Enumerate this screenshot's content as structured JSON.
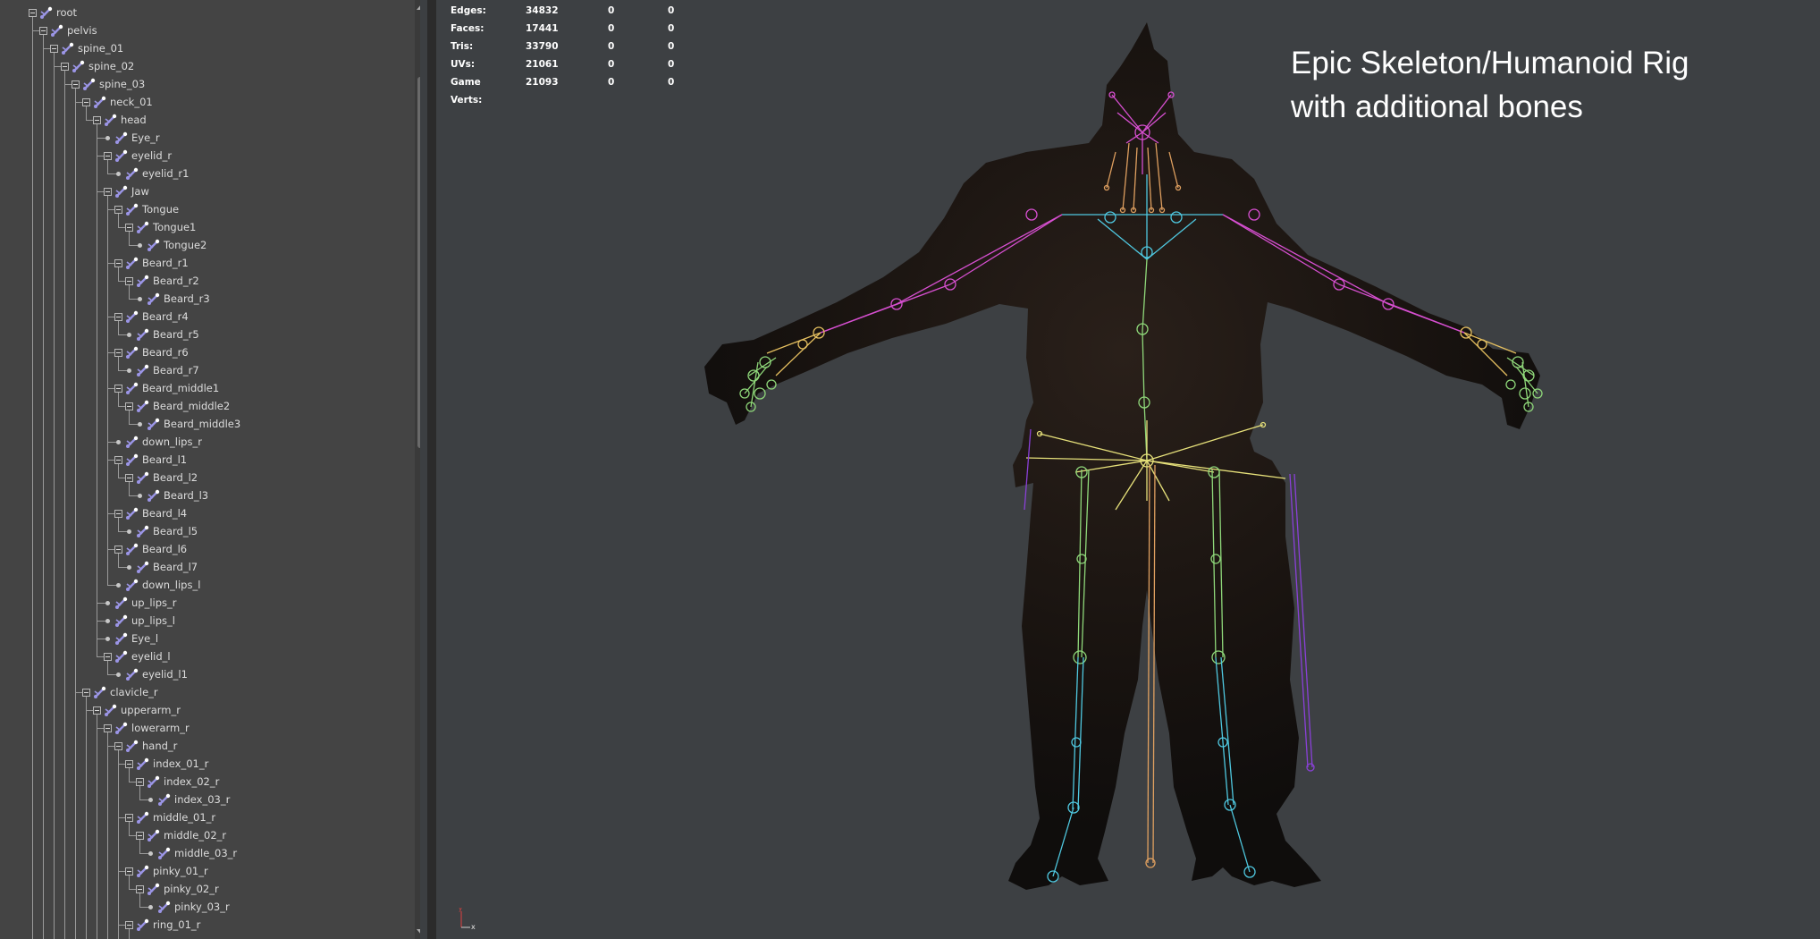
{
  "outliner": {
    "nodes": [
      {
        "label": "root",
        "depth": 0,
        "exp": true
      },
      {
        "label": "pelvis",
        "depth": 1,
        "exp": true
      },
      {
        "label": "spine_01",
        "depth": 2,
        "exp": true
      },
      {
        "label": "spine_02",
        "depth": 3,
        "exp": true
      },
      {
        "label": "spine_03",
        "depth": 4,
        "exp": true
      },
      {
        "label": "neck_01",
        "depth": 5,
        "exp": true
      },
      {
        "label": "head",
        "depth": 6,
        "exp": true
      },
      {
        "label": "Eye_r",
        "depth": 7,
        "exp": false
      },
      {
        "label": "eyelid_r",
        "depth": 7,
        "exp": true
      },
      {
        "label": "eyelid_r1",
        "depth": 8,
        "exp": false
      },
      {
        "label": "Jaw",
        "depth": 7,
        "exp": true
      },
      {
        "label": "Tongue",
        "depth": 8,
        "exp": true
      },
      {
        "label": "Tongue1",
        "depth": 9,
        "exp": true
      },
      {
        "label": "Tongue2",
        "depth": 10,
        "exp": false
      },
      {
        "label": "Beard_r1",
        "depth": 8,
        "exp": true
      },
      {
        "label": "Beard_r2",
        "depth": 9,
        "exp": true
      },
      {
        "label": "Beard_r3",
        "depth": 10,
        "exp": false
      },
      {
        "label": "Beard_r4",
        "depth": 8,
        "exp": true
      },
      {
        "label": "Beard_r5",
        "depth": 9,
        "exp": false
      },
      {
        "label": "Beard_r6",
        "depth": 8,
        "exp": true
      },
      {
        "label": "Beard_r7",
        "depth": 9,
        "exp": false
      },
      {
        "label": "Beard_middle1",
        "depth": 8,
        "exp": true
      },
      {
        "label": "Beard_middle2",
        "depth": 9,
        "exp": true
      },
      {
        "label": "Beard_middle3",
        "depth": 10,
        "exp": false
      },
      {
        "label": "down_lips_r",
        "depth": 8,
        "exp": false
      },
      {
        "label": "Beard_l1",
        "depth": 8,
        "exp": true
      },
      {
        "label": "Beard_l2",
        "depth": 9,
        "exp": true
      },
      {
        "label": "Beard_l3",
        "depth": 10,
        "exp": false
      },
      {
        "label": "Beard_l4",
        "depth": 8,
        "exp": true
      },
      {
        "label": "Beard_l5",
        "depth": 9,
        "exp": false
      },
      {
        "label": "Beard_l6",
        "depth": 8,
        "exp": true
      },
      {
        "label": "Beard_l7",
        "depth": 9,
        "exp": false
      },
      {
        "label": "down_lips_l",
        "depth": 8,
        "exp": false
      },
      {
        "label": "up_lips_r",
        "depth": 7,
        "exp": false
      },
      {
        "label": "up_lips_l",
        "depth": 7,
        "exp": false
      },
      {
        "label": "Eye_l",
        "depth": 7,
        "exp": false
      },
      {
        "label": "eyelid_l",
        "depth": 7,
        "exp": true
      },
      {
        "label": "eyelid_l1",
        "depth": 8,
        "exp": false
      },
      {
        "label": "clavicle_r",
        "depth": 5,
        "exp": true
      },
      {
        "label": "upperarm_r",
        "depth": 6,
        "exp": true
      },
      {
        "label": "lowerarm_r",
        "depth": 7,
        "exp": true
      },
      {
        "label": "hand_r",
        "depth": 8,
        "exp": true
      },
      {
        "label": "index_01_r",
        "depth": 9,
        "exp": true
      },
      {
        "label": "index_02_r",
        "depth": 10,
        "exp": true
      },
      {
        "label": "index_03_r",
        "depth": 11,
        "exp": false
      },
      {
        "label": "middle_01_r",
        "depth": 9,
        "exp": true
      },
      {
        "label": "middle_02_r",
        "depth": 10,
        "exp": true
      },
      {
        "label": "middle_03_r",
        "depth": 11,
        "exp": false
      },
      {
        "label": "pinky_01_r",
        "depth": 9,
        "exp": true
      },
      {
        "label": "pinky_02_r",
        "depth": 10,
        "exp": true
      },
      {
        "label": "pinky_03_r",
        "depth": 11,
        "exp": false
      },
      {
        "label": "ring_01_r",
        "depth": 9,
        "exp": true
      }
    ]
  },
  "hud": {
    "rows": [
      {
        "label": "Edges:",
        "v1": "34832",
        "v2": "0",
        "v3": "0"
      },
      {
        "label": "Faces:",
        "v1": "17441",
        "v2": "0",
        "v3": "0"
      },
      {
        "label": "Tris:",
        "v1": "33790",
        "v2": "0",
        "v3": "0"
      },
      {
        "label": "UVs:",
        "v1": "21061",
        "v2": "0",
        "v3": "0"
      },
      {
        "label": "Game Verts:",
        "v1": "21093",
        "v2": "0",
        "v3": "0"
      }
    ]
  },
  "overlay": {
    "title_line1": "Epic Skeleton/Humanoid Rig",
    "title_line2": "with additional bones"
  },
  "axis": {
    "y_label": "y",
    "x_label": "x"
  },
  "colors": {
    "panel_bg": "#444444",
    "viewport_bg": "#3d4043",
    "joint_icon": "#9b95e6",
    "rig_pink": "#d64fd0",
    "rig_cyan": "#4fc8e0",
    "rig_yellow": "#e6e07a",
    "rig_green": "#8fd87a",
    "rig_purple": "#8a40d8",
    "rig_orange": "#e0a060"
  }
}
